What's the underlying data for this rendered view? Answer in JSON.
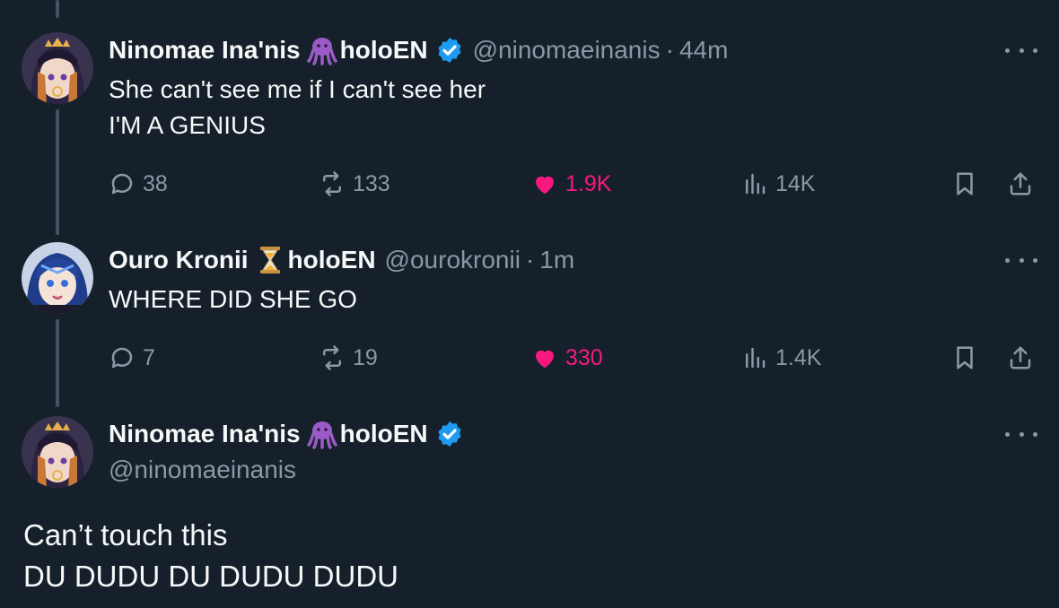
{
  "tweets": [
    {
      "name": "Ninomae Ina'nis",
      "emoji_icon": "octopus-icon",
      "suffix": "holoEN",
      "verified": true,
      "handle": "@ninomaeinanis",
      "separator": "·",
      "time": "44m",
      "lines": [
        "She can't see me if I can't see her",
        "I'M A GENIUS"
      ],
      "replies": "38",
      "retweets": "133",
      "likes": "1.9K",
      "views": "14K"
    },
    {
      "name": "Ouro Kronii",
      "emoji_icon": "hourglass-icon",
      "suffix": "holoEN",
      "verified": false,
      "handle": "@ourokronii",
      "separator": "·",
      "time": "1m",
      "lines": [
        "WHERE DID SHE GO"
      ],
      "replies": "7",
      "retweets": "19",
      "likes": "330",
      "views": "1.4K"
    }
  ],
  "main_tweet": {
    "name": "Ninomae Ina'nis",
    "emoji_icon": "octopus-icon",
    "suffix": "holoEN",
    "verified": true,
    "handle": "@ninomaeinanis",
    "lines": [
      "Can’t touch this",
      "DU DUDU DU DUDU DUDU"
    ]
  },
  "colors": {
    "background": "#15202b",
    "text": "#f7f9f9",
    "muted": "#8b98a5",
    "like": "#f91880",
    "verified": "#1d9bf0",
    "thread_line": "#425364"
  }
}
